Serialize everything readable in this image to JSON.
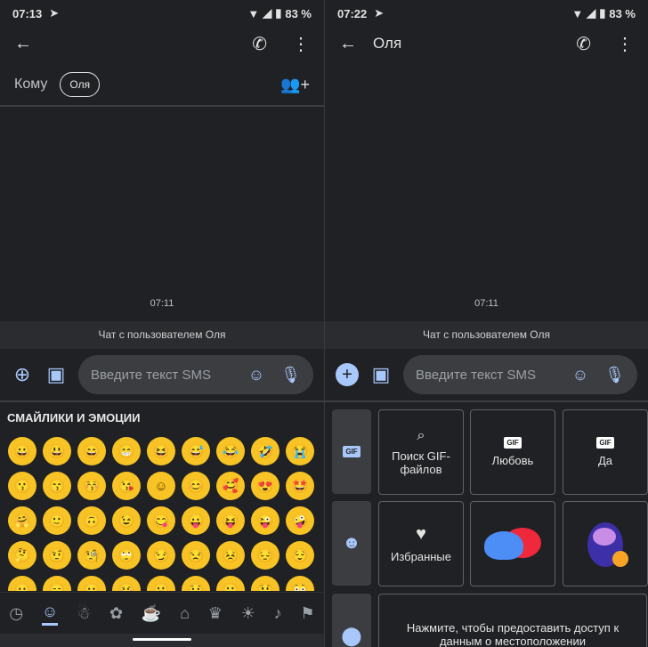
{
  "left": {
    "status": {
      "time": "07:13",
      "battery": "83 %"
    },
    "to_label": "Кому",
    "chip": "Оля",
    "timestamp": "07:11",
    "band": "Чат с пользователем Оля",
    "input_placeholder": "Введите текст SMS",
    "emoji_header": "СМАЙЛИКИ И ЭМОЦИИ",
    "emojis": [
      "😀",
      "😃",
      "😄",
      "😁",
      "😆",
      "😅",
      "😂",
      "🤣",
      "😭",
      "😗",
      "😙",
      "😚",
      "😘",
      "☺",
      "😊",
      "🥰",
      "😍",
      "🤩",
      "🤗",
      "🙂",
      "🙃",
      "😉",
      "😋",
      "😛",
      "😝",
      "😜",
      "🤪",
      "🤔",
      "🤨",
      "🧐",
      "🙄",
      "😏",
      "😒",
      "😣",
      "😔",
      "😌",
      "😐",
      "😑",
      "😶",
      "🥴",
      "😬",
      "😯",
      "😮",
      "😲",
      "😳"
    ],
    "categories": [
      {
        "icon": "clock-icon",
        "g": "◷"
      },
      {
        "icon": "smiley-icon",
        "g": "☺"
      },
      {
        "icon": "person-icon",
        "g": "☃"
      },
      {
        "icon": "animals-icon",
        "g": "✿"
      },
      {
        "icon": "food-icon",
        "g": "☕"
      },
      {
        "icon": "travel-icon",
        "g": "⌂"
      },
      {
        "icon": "trophy-icon",
        "g": "♛"
      },
      {
        "icon": "bulb-icon",
        "g": "☀"
      },
      {
        "icon": "symbols-icon",
        "g": "♪"
      },
      {
        "icon": "flag-icon",
        "g": "⚑"
      }
    ]
  },
  "right": {
    "status": {
      "time": "07:22",
      "battery": "83 %"
    },
    "title": "Оля",
    "timestamp": "07:11",
    "band": "Чат с пользователем Оля",
    "input_placeholder": "Введите текст SMS",
    "gif_tab": "GIF",
    "gif_search": "Поиск GIF-файлов",
    "gif_love": "Любовь",
    "gif_yes": "Да",
    "gif_badge": "GIF",
    "favorites": "Избранные",
    "location": "Нажмите, чтобы предоставить доступ к данным о местоположении"
  },
  "colors": {
    "accent": "#a8c7fa",
    "background": "#202124",
    "emoji": "#f7c325"
  }
}
